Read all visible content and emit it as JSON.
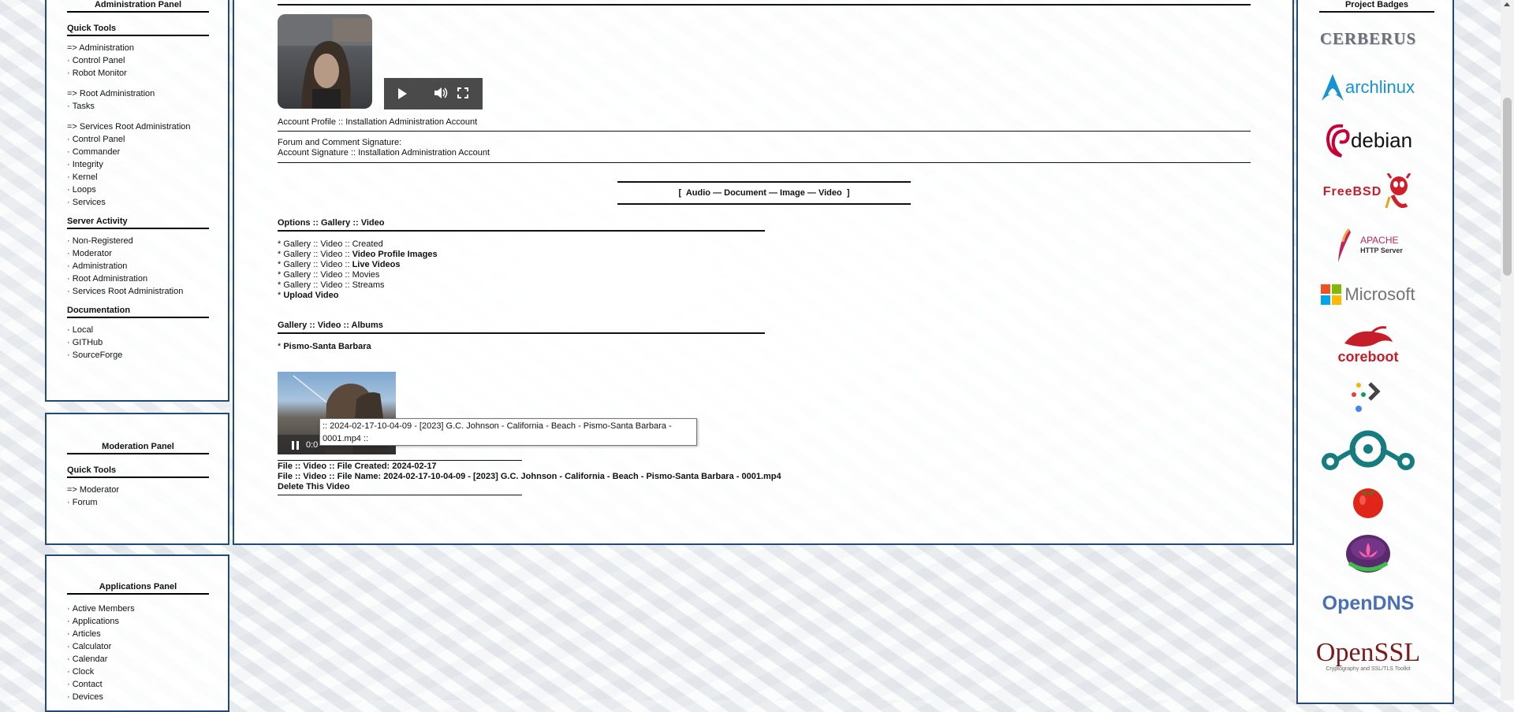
{
  "admin_panel": {
    "title": "Administration Panel",
    "quick_tools": "Quick Tools",
    "admin_group_label": "=> Administration",
    "admin_items": [
      "Control Panel",
      "Robot Monitor"
    ],
    "root_group_label": "=> Root Administration",
    "root_items": [
      "Tasks"
    ],
    "services_group_label": "=> Services Root Administration",
    "services_items": [
      "Control Panel",
      "Commander",
      "Integrity",
      "Kernel",
      "Loops",
      "Services"
    ],
    "server_activity": "Server Activity",
    "activity_items": [
      "Non-Registered",
      "Moderator",
      "Administration",
      "Root Administration",
      "Services Root Administration"
    ],
    "documentation": "Documentation",
    "doc_items": [
      "Local",
      "GITHub",
      "SourceForge"
    ]
  },
  "moderation_panel": {
    "title": "Moderation Panel",
    "quick_tools": "Quick Tools",
    "group_label": "=> Moderator",
    "items": [
      "Forum"
    ]
  },
  "applications_panel": {
    "title": "Applications Panel",
    "items": [
      "Active Members",
      "Applications",
      "Articles",
      "Calculator",
      "Calendar",
      "Clock",
      "Contact",
      "Devices"
    ]
  },
  "main": {
    "account_profile": "Account Profile :: Installation Administration Account",
    "forum_signature_label": "Forum and Comment Signature:",
    "account_signature": "Account Signature :: Installation Administration Account",
    "media_nav": {
      "open": "[",
      "close": "]",
      "sep": "—",
      "items": [
        "Audio",
        "Document",
        "Image",
        "Video"
      ]
    },
    "options_title": "Options :: Gallery :: Video",
    "options": [
      {
        "prefix": "* Gallery :: Video :: ",
        "label": "Created",
        "bold": false
      },
      {
        "prefix": "* Gallery :: Video :: ",
        "label": "Video Profile Images",
        "bold": true
      },
      {
        "prefix": "* Gallery :: Video :: ",
        "label": "Live Videos",
        "bold": true
      },
      {
        "prefix": "* Gallery :: Video :: ",
        "label": "Movies",
        "bold": false
      },
      {
        "prefix": "* Gallery :: Video :: ",
        "label": "Streams",
        "bold": false
      },
      {
        "prefix": "* ",
        "label": "Upload Video",
        "bold": true
      }
    ],
    "albums_title": "Gallery :: Video :: Albums",
    "album_prefix": "* ",
    "album_name": "Pismo-Santa Barbara",
    "player_time": "0:0",
    "tooltip": ":: 2024-02-17-10-04-09 - [2023] G.C. Johnson - California - Beach - Pismo-Santa Barbara - 0001.mp4 ::",
    "file_created_label": "File :: Video :: File Created:",
    "file_created_value": "2024-02-17",
    "file_name_label": "File :: Video :: File Name:",
    "file_name_value": "2024-02-17-10-04-09 - [2023] G.C. Johnson - California - Beach - Pismo-Santa Barbara - 0001.mp4",
    "delete_label": "Delete This Video"
  },
  "badges_panel": {
    "title": "Project Badges",
    "badges": [
      "CERBERUS",
      "archlinux",
      "debian",
      "FreeBSD",
      "APACHE",
      "HTTP Server",
      "Microsoft",
      "coreboot",
      "OpenDNS",
      "OpenSSL",
      "Cryptography and SSL/TLS Toolkit"
    ]
  },
  "colors": {
    "panel_border": "#234a74",
    "debian_red": "#c70036",
    "arch_blue": "#1793d1",
    "coreboot_red": "#c41e2a",
    "opendns_blue": "#4a6fb5"
  }
}
